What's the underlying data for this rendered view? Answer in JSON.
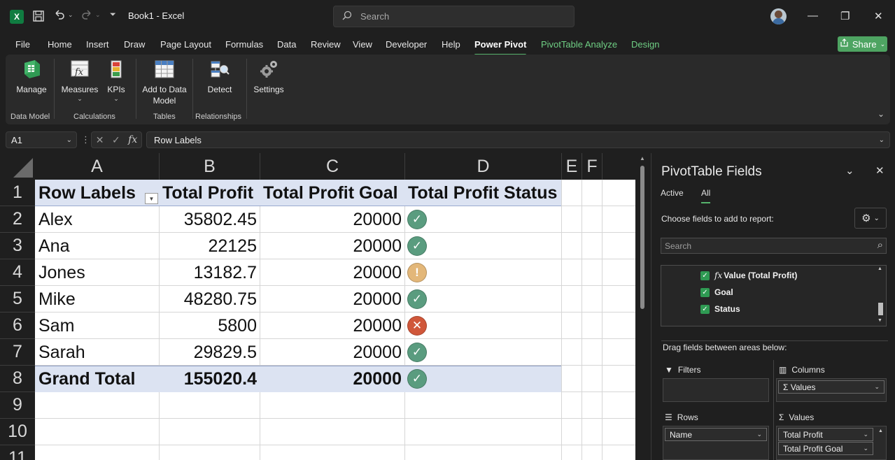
{
  "app": {
    "logo_letter": "X",
    "document_title": "Book1  -  Excel",
    "search_placeholder": "Search"
  },
  "window": {
    "minimize": "—",
    "restore": "❐",
    "close": "✕"
  },
  "menu": {
    "tabs": [
      "File",
      "Home",
      "Insert",
      "Draw",
      "Page Layout",
      "Formulas",
      "Data",
      "Review",
      "View",
      "Developer",
      "Help",
      "Power Pivot",
      "PivotTable Analyze",
      "Design"
    ],
    "active_tab": "Power Pivot",
    "share_label": "Share"
  },
  "ribbon": {
    "buttons": {
      "manage": "Manage",
      "measures": "Measures",
      "kpis": "KPIs",
      "add_to_data_model": "Add to Data Model",
      "detect": "Detect",
      "settings": "Settings"
    },
    "groups": {
      "data_model": "Data Model",
      "calculations": "Calculations",
      "tables": "Tables",
      "relationships": "Relationships"
    }
  },
  "formula_bar": {
    "name_box": "A1",
    "formula": "Row Labels"
  },
  "sheet": {
    "columns": [
      "A",
      "B",
      "C",
      "D",
      "E",
      "F"
    ],
    "rows": [
      "1",
      "2",
      "3",
      "4",
      "5",
      "6",
      "7",
      "8",
      "9",
      "10",
      "11"
    ],
    "pivot_headers": [
      "Row Labels",
      "Total Profit",
      "Total Profit Goal",
      "Total Profit Status"
    ],
    "pivot_rows": [
      {
        "name": "Alex",
        "profit": "35802.45",
        "goal": "20000",
        "status": "ok"
      },
      {
        "name": "Ana",
        "profit": "22125",
        "goal": "20000",
        "status": "ok"
      },
      {
        "name": "Jones",
        "profit": "13182.7",
        "goal": "20000",
        "status": "warn"
      },
      {
        "name": "Mike",
        "profit": "48280.75",
        "goal": "20000",
        "status": "ok"
      },
      {
        "name": "Sam",
        "profit": "5800",
        "goal": "20000",
        "status": "bad"
      },
      {
        "name": "Sarah",
        "profit": "29829.5",
        "goal": "20000",
        "status": "ok"
      }
    ],
    "grand_total": {
      "label": "Grand Total",
      "profit": "155020.4",
      "goal": "20000",
      "status": "ok"
    },
    "status_glyphs": {
      "ok": "✓",
      "warn": "!",
      "bad": "✕"
    },
    "status_colors": {
      "ok": "#5a9c7f",
      "warn": "#e3b779",
      "bad": "#d0573a"
    }
  },
  "pivot_pane": {
    "title": "PivotTable Fields",
    "tabs": [
      "Active",
      "All"
    ],
    "selected_tab": "All",
    "choose_label": "Choose fields to add to report:",
    "search_placeholder": "Search",
    "fields": [
      "Value (Total Profit)",
      "Goal",
      "Status"
    ],
    "drag_label": "Drag fields between areas below:",
    "areas": {
      "filters": "Filters",
      "columns": "Columns",
      "rows": "Rows",
      "values": "Values",
      "columns_items": [
        "Σ Values"
      ],
      "rows_items": [
        "Name"
      ],
      "values_items": [
        "Total Profit",
        "Total Profit Goal"
      ]
    }
  }
}
